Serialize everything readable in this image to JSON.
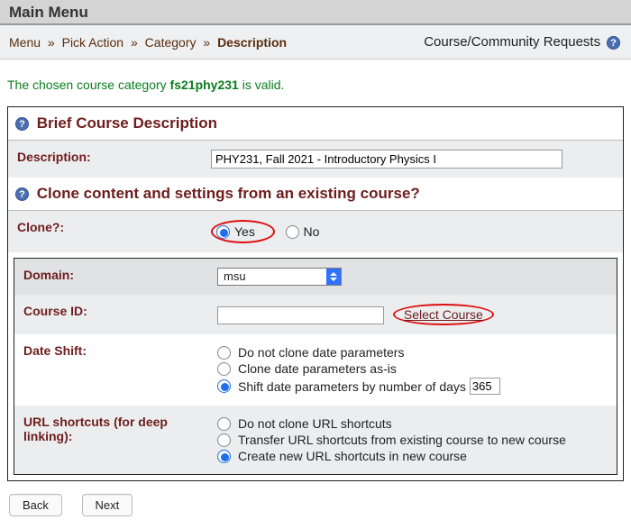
{
  "header": {
    "title": "Main Menu"
  },
  "breadcrumb": {
    "items": [
      "Menu",
      "Pick Action",
      "Category",
      "Description"
    ],
    "current_index": 3,
    "right_link": "Course/Community Requests"
  },
  "message": {
    "prefix": "The chosen course category ",
    "code": "fs21phy231",
    "suffix": " is valid."
  },
  "section_desc": {
    "title": "Brief Course Description",
    "label": "Description:",
    "value": "PHY231, Fall 2021 - Introductory Physics I"
  },
  "section_clone": {
    "title": "Clone content and settings from an existing course?",
    "clone_label": "Clone?:",
    "yes": "Yes",
    "no": "No",
    "domain_label": "Domain:",
    "domain_value": "msu",
    "courseid_label": "Course ID:",
    "select_course": "Select Course",
    "dateshift_label": "Date Shift:",
    "dateshift_opts": [
      "Do not clone date parameters",
      "Clone date parameters as-is",
      "Shift date parameters by number of days"
    ],
    "days_value": "365",
    "url_label": "URL shortcuts (for deep linking):",
    "url_opts": [
      "Do not clone URL shortcuts",
      "Transfer URL shortcuts from existing course to new course",
      "Create new URL shortcuts in new course"
    ]
  },
  "buttons": {
    "back": "Back",
    "next": "Next"
  }
}
